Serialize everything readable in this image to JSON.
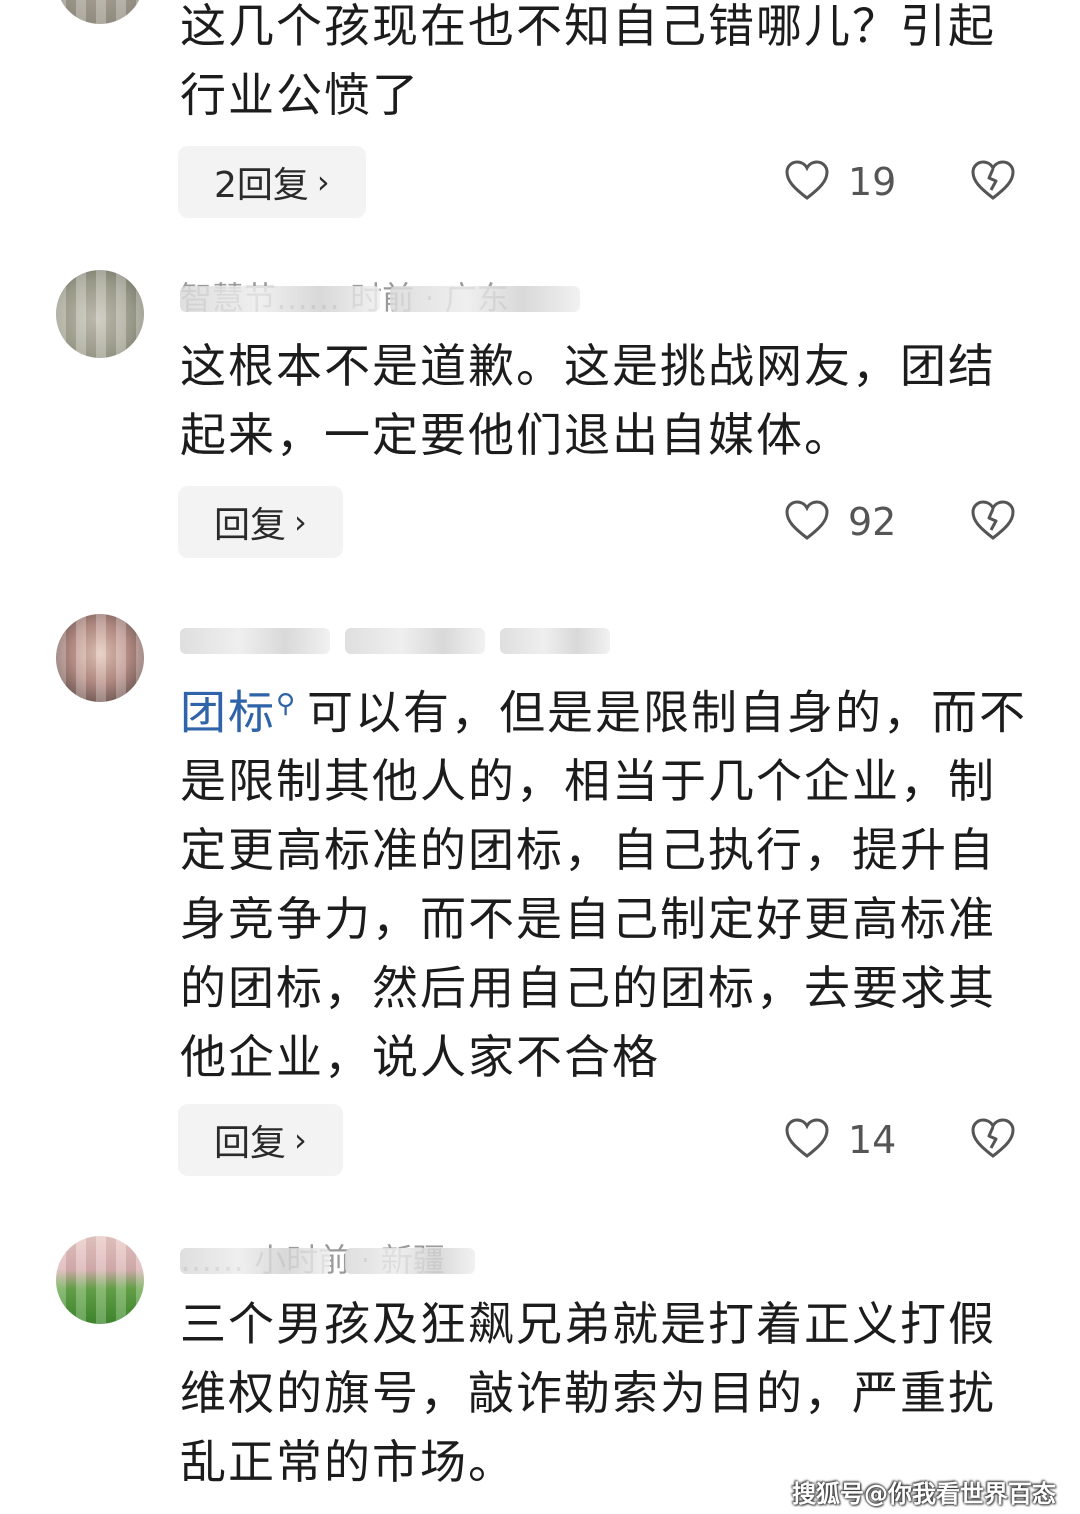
{
  "comments": [
    {
      "meta": "",
      "text": "这几个孩现在也不知自己错哪儿？引起行业公愤了",
      "reply_label": "2回复",
      "likes": "19"
    },
    {
      "meta": "智慧节…… 时前 · 广东",
      "text": "这根本不是道歉。这是挑战网友，团结起来，一定要他们退出自媒体。",
      "reply_label": "回复",
      "likes": "92"
    },
    {
      "meta": "",
      "hashtag": "团标",
      "text": "可以有，但是是限制自身的，而不是限制其他人的，相当于几个企业，制定更高标准的团标，自己执行，提升自身竞争力，而不是自己制定好更高标准的团标，然后用自己的团标，去要求其他企业，说人家不合格",
      "reply_label": "回复",
      "likes": "14"
    },
    {
      "meta": "…… 小时前 · 新疆",
      "text": "三个男孩及狂飙兄弟就是打着正义打假维权的旗号，敲诈勒索为目的，严重扰乱正常的市场。"
    }
  ],
  "reply_chevron": "›",
  "hashtag_icon": "search-icon",
  "like_icon": "heart-outline-icon",
  "dislike_icon": "broken-heart-icon",
  "watermark": "搜狐号@你我看世界百态",
  "colors": {
    "text": "#1c1c1c",
    "meta": "#9a9a9a",
    "hashtag": "#2f64a8",
    "button_bg": "#f3f3f3",
    "icon": "#555555"
  }
}
